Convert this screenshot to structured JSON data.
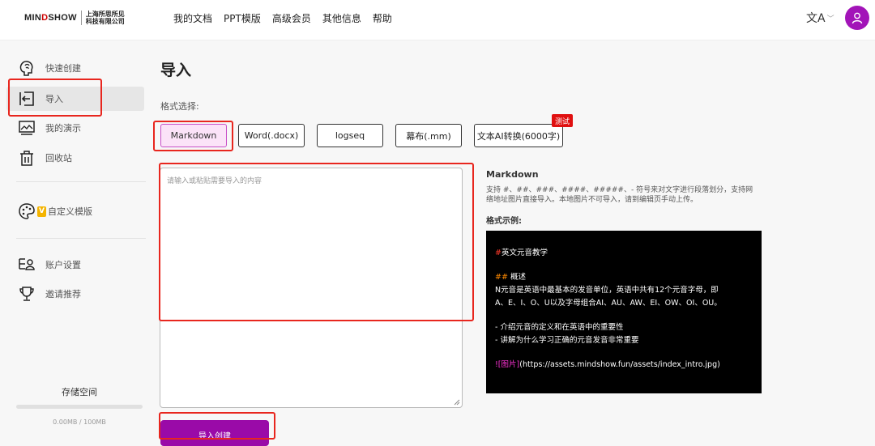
{
  "logo": {
    "brand_pre": "MIN",
    "brand_o": "D",
    "brand_post": "SHOW",
    "company_line1": "上海所思所见",
    "company_line2": "科技有限公司"
  },
  "nav": [
    "我的文档",
    "PPT模版",
    "高级会员",
    "其他信息",
    "帮助"
  ],
  "header": {
    "lang_icon": "文A",
    "lang_chevron": "﹀"
  },
  "sidebar": {
    "items": [
      {
        "label": "快速创建",
        "icon": "brain-icon"
      },
      {
        "label": "导入",
        "icon": "import-icon"
      },
      {
        "label": "我的演示",
        "icon": "presentation-icon"
      },
      {
        "label": "回收站",
        "icon": "trash-icon"
      },
      {
        "label": "自定义模版",
        "icon": "palette-icon",
        "badge": "V"
      },
      {
        "label": "账户设置",
        "icon": "account-icon"
      },
      {
        "label": "邀请推荐",
        "icon": "trophy-icon"
      }
    ],
    "storage_label": "存储空间",
    "storage_value": "0.00MB / 100MB",
    "storage_fraction": 0.0
  },
  "main": {
    "title": "导入",
    "format_label": "格式选择:",
    "formats": [
      "Markdown",
      "Word(.docx)",
      "logseq",
      "幕布(.mm)",
      "文本AI转换(6000字)"
    ],
    "selected_format": "Markdown",
    "test_badge": "测试",
    "input_placeholder": "请输入或粘贴需要导入的内容",
    "import_button": "导入创建"
  },
  "info": {
    "title": "Markdown",
    "desc_line1": "支持 #、##、###、####、#####、- 符号来对文字进行段落划分，支持网",
    "desc_line2": "络地址图片直接导入。本地图片不可导入，请到编辑页手动上传。",
    "example_label": "格式示例:",
    "example": {
      "h1_mark": "#",
      "h1_text": "英文元音教学",
      "h2_mark": "##",
      "h2_text": " 概述",
      "para1": " N元音是英语中最基本的发音单位，英语中共有12个元音字母，即",
      "para2": "A、E、I、O、U以及字母组合AI、AU、AW、EI、OW、OI、OU。",
      "li1": "- 介绍元音的定义和在英语中的重要性",
      "li2": "- 讲解为什么学习正确的元音发音非常重要",
      "img_mark": "![图片]",
      "img_url": "(https://assets.mindshow.fun/assets/index_intro.jpg)"
    }
  },
  "colors": {
    "accent": "#9a0aa8",
    "annotation": "#e8261e",
    "badge": "#e01010"
  }
}
